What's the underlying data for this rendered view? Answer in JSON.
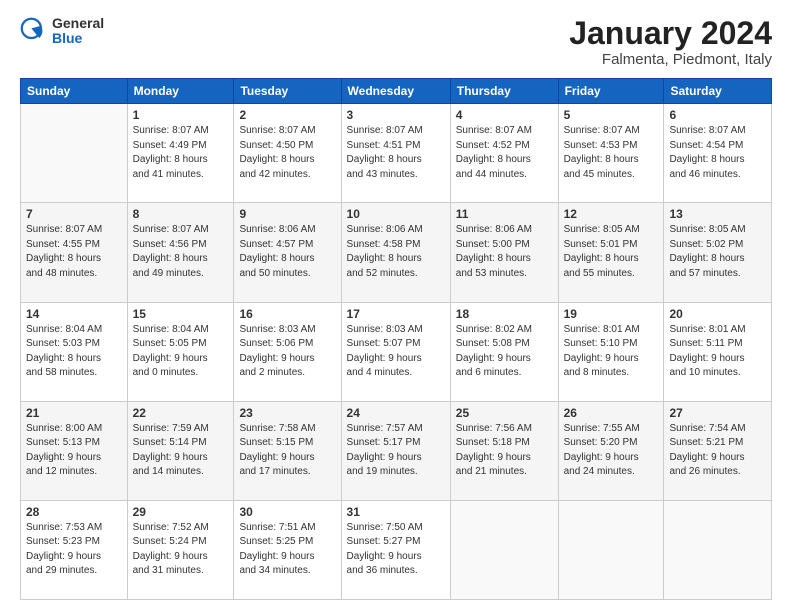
{
  "logo": {
    "general": "General",
    "blue": "Blue"
  },
  "header": {
    "title": "January 2024",
    "location": "Falmenta, Piedmont, Italy"
  },
  "weekdays": [
    "Sunday",
    "Monday",
    "Tuesday",
    "Wednesday",
    "Thursday",
    "Friday",
    "Saturday"
  ],
  "weeks": [
    [
      {
        "day": "",
        "info": ""
      },
      {
        "day": "1",
        "info": "Sunrise: 8:07 AM\nSunset: 4:49 PM\nDaylight: 8 hours\nand 41 minutes."
      },
      {
        "day": "2",
        "info": "Sunrise: 8:07 AM\nSunset: 4:50 PM\nDaylight: 8 hours\nand 42 minutes."
      },
      {
        "day": "3",
        "info": "Sunrise: 8:07 AM\nSunset: 4:51 PM\nDaylight: 8 hours\nand 43 minutes."
      },
      {
        "day": "4",
        "info": "Sunrise: 8:07 AM\nSunset: 4:52 PM\nDaylight: 8 hours\nand 44 minutes."
      },
      {
        "day": "5",
        "info": "Sunrise: 8:07 AM\nSunset: 4:53 PM\nDaylight: 8 hours\nand 45 minutes."
      },
      {
        "day": "6",
        "info": "Sunrise: 8:07 AM\nSunset: 4:54 PM\nDaylight: 8 hours\nand 46 minutes."
      }
    ],
    [
      {
        "day": "7",
        "info": "Sunrise: 8:07 AM\nSunset: 4:55 PM\nDaylight: 8 hours\nand 48 minutes."
      },
      {
        "day": "8",
        "info": "Sunrise: 8:07 AM\nSunset: 4:56 PM\nDaylight: 8 hours\nand 49 minutes."
      },
      {
        "day": "9",
        "info": "Sunrise: 8:06 AM\nSunset: 4:57 PM\nDaylight: 8 hours\nand 50 minutes."
      },
      {
        "day": "10",
        "info": "Sunrise: 8:06 AM\nSunset: 4:58 PM\nDaylight: 8 hours\nand 52 minutes."
      },
      {
        "day": "11",
        "info": "Sunrise: 8:06 AM\nSunset: 5:00 PM\nDaylight: 8 hours\nand 53 minutes."
      },
      {
        "day": "12",
        "info": "Sunrise: 8:05 AM\nSunset: 5:01 PM\nDaylight: 8 hours\nand 55 minutes."
      },
      {
        "day": "13",
        "info": "Sunrise: 8:05 AM\nSunset: 5:02 PM\nDaylight: 8 hours\nand 57 minutes."
      }
    ],
    [
      {
        "day": "14",
        "info": "Sunrise: 8:04 AM\nSunset: 5:03 PM\nDaylight: 8 hours\nand 58 minutes."
      },
      {
        "day": "15",
        "info": "Sunrise: 8:04 AM\nSunset: 5:05 PM\nDaylight: 9 hours\nand 0 minutes."
      },
      {
        "day": "16",
        "info": "Sunrise: 8:03 AM\nSunset: 5:06 PM\nDaylight: 9 hours\nand 2 minutes."
      },
      {
        "day": "17",
        "info": "Sunrise: 8:03 AM\nSunset: 5:07 PM\nDaylight: 9 hours\nand 4 minutes."
      },
      {
        "day": "18",
        "info": "Sunrise: 8:02 AM\nSunset: 5:08 PM\nDaylight: 9 hours\nand 6 minutes."
      },
      {
        "day": "19",
        "info": "Sunrise: 8:01 AM\nSunset: 5:10 PM\nDaylight: 9 hours\nand 8 minutes."
      },
      {
        "day": "20",
        "info": "Sunrise: 8:01 AM\nSunset: 5:11 PM\nDaylight: 9 hours\nand 10 minutes."
      }
    ],
    [
      {
        "day": "21",
        "info": "Sunrise: 8:00 AM\nSunset: 5:13 PM\nDaylight: 9 hours\nand 12 minutes."
      },
      {
        "day": "22",
        "info": "Sunrise: 7:59 AM\nSunset: 5:14 PM\nDaylight: 9 hours\nand 14 minutes."
      },
      {
        "day": "23",
        "info": "Sunrise: 7:58 AM\nSunset: 5:15 PM\nDaylight: 9 hours\nand 17 minutes."
      },
      {
        "day": "24",
        "info": "Sunrise: 7:57 AM\nSunset: 5:17 PM\nDaylight: 9 hours\nand 19 minutes."
      },
      {
        "day": "25",
        "info": "Sunrise: 7:56 AM\nSunset: 5:18 PM\nDaylight: 9 hours\nand 21 minutes."
      },
      {
        "day": "26",
        "info": "Sunrise: 7:55 AM\nSunset: 5:20 PM\nDaylight: 9 hours\nand 24 minutes."
      },
      {
        "day": "27",
        "info": "Sunrise: 7:54 AM\nSunset: 5:21 PM\nDaylight: 9 hours\nand 26 minutes."
      }
    ],
    [
      {
        "day": "28",
        "info": "Sunrise: 7:53 AM\nSunset: 5:23 PM\nDaylight: 9 hours\nand 29 minutes."
      },
      {
        "day": "29",
        "info": "Sunrise: 7:52 AM\nSunset: 5:24 PM\nDaylight: 9 hours\nand 31 minutes."
      },
      {
        "day": "30",
        "info": "Sunrise: 7:51 AM\nSunset: 5:25 PM\nDaylight: 9 hours\nand 34 minutes."
      },
      {
        "day": "31",
        "info": "Sunrise: 7:50 AM\nSunset: 5:27 PM\nDaylight: 9 hours\nand 36 minutes."
      },
      {
        "day": "",
        "info": ""
      },
      {
        "day": "",
        "info": ""
      },
      {
        "day": "",
        "info": ""
      }
    ]
  ]
}
